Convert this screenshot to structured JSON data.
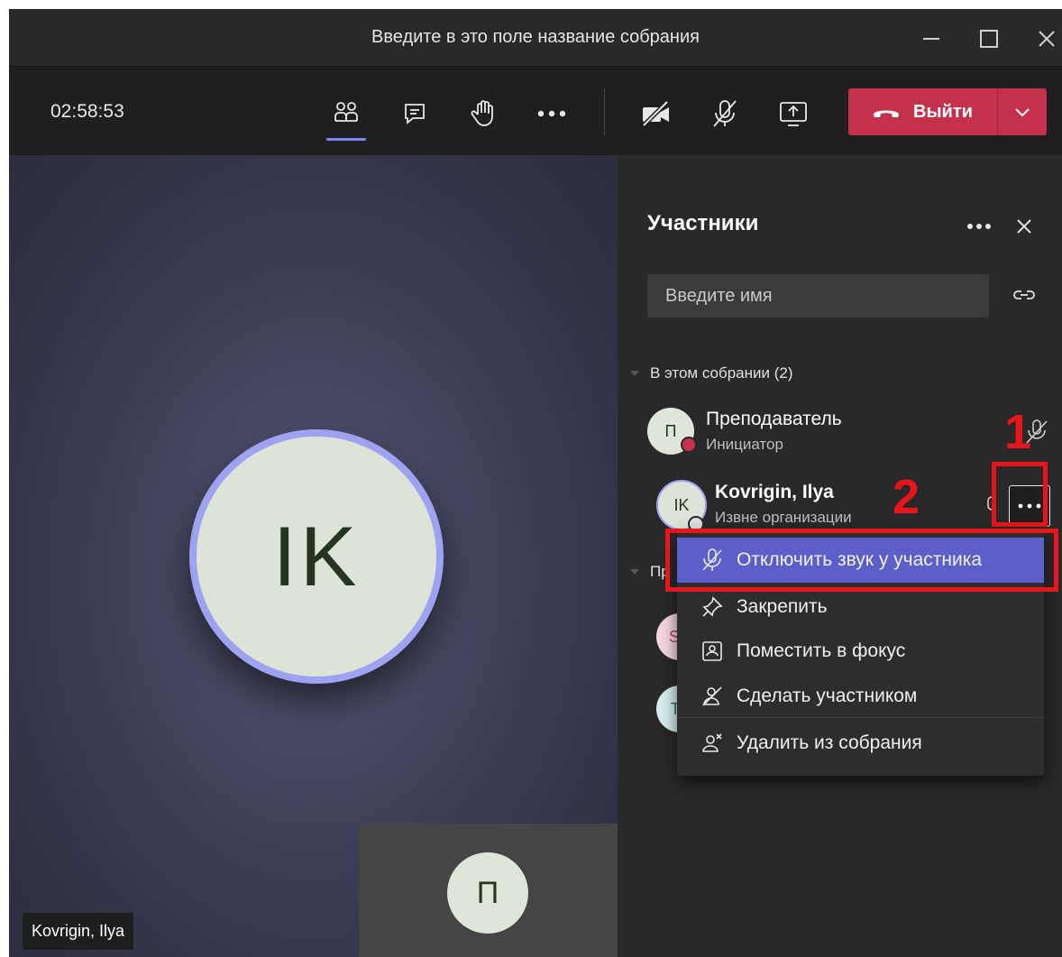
{
  "window": {
    "title": "Введите в это поле название собрания"
  },
  "toolbar": {
    "timer": "02:58:53",
    "leave_label": "Выйти"
  },
  "stage": {
    "main_avatar_initials": "IK",
    "name_tag": "Kovrigin, Ilya",
    "self_avatar_initial": "П"
  },
  "panel": {
    "title": "Участники",
    "search_placeholder": "Введите имя",
    "section_in_meeting": "В этом собрании (2)",
    "section_second_partial": "Пр",
    "participants": [
      {
        "initials": "П",
        "name": "Преподаватель",
        "role": "Инициатор",
        "avatar_bg": "#dde6d9",
        "status_color": "#c4314b"
      },
      {
        "initials": "IK",
        "name": "Kovrigin, Ilya",
        "role": "Извне организации",
        "avatar_bg": "#dde3d6"
      }
    ],
    "partial_participants": [
      {
        "initials": "SA",
        "avatar_bg": "#f4d7e0",
        "color": "#b43b67"
      },
      {
        "initials": "ТГ",
        "avatar_bg": "#d6eeee",
        "color": "#2d6e6e"
      }
    ]
  },
  "context_menu": {
    "items": [
      {
        "label": "Отключить звук у участника",
        "icon": "mic-off-icon",
        "active": true
      },
      {
        "label": "Закрепить",
        "icon": "pin-icon",
        "active": false
      },
      {
        "label": "Поместить в фокус",
        "icon": "spotlight-icon",
        "active": false
      },
      {
        "label": "Сделать участником",
        "icon": "make-attendee-icon",
        "active": false
      },
      {
        "label": "Удалить из собрания",
        "icon": "remove-person-icon",
        "active": false
      }
    ]
  },
  "annotations": {
    "step1": "1",
    "step2": "2",
    "color": "#e8161c"
  },
  "colors": {
    "accent": "#5b5fc7",
    "leave": "#c4314b",
    "ring": "#9ea2f0"
  }
}
